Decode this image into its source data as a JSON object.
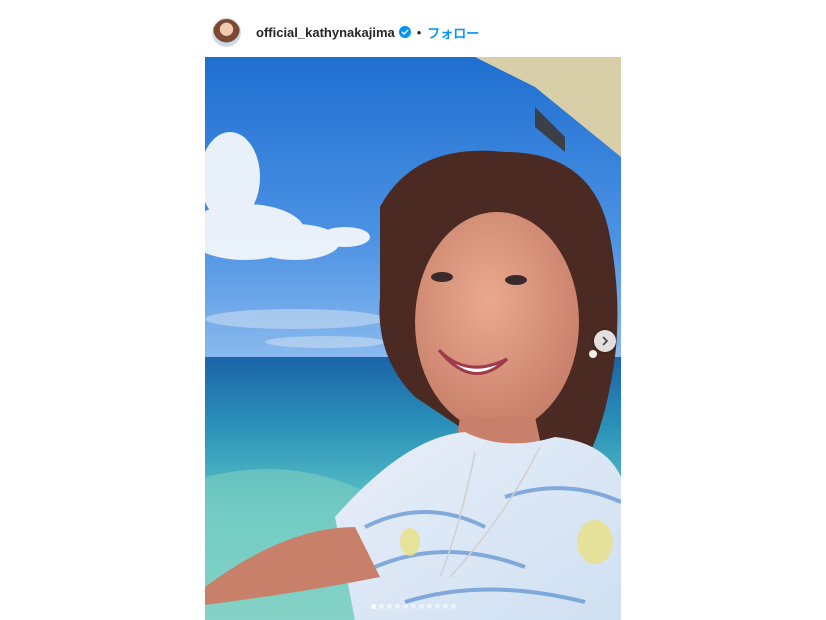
{
  "post": {
    "username": "official_kathynakajima",
    "separator": "•",
    "follow_label": "フォロー",
    "verified_icon": "verified-badge-icon",
    "accent_color": "#0095f6"
  },
  "carousel": {
    "total_slides": 11,
    "current_index": 0,
    "next_icon": "chevron-right-icon"
  }
}
